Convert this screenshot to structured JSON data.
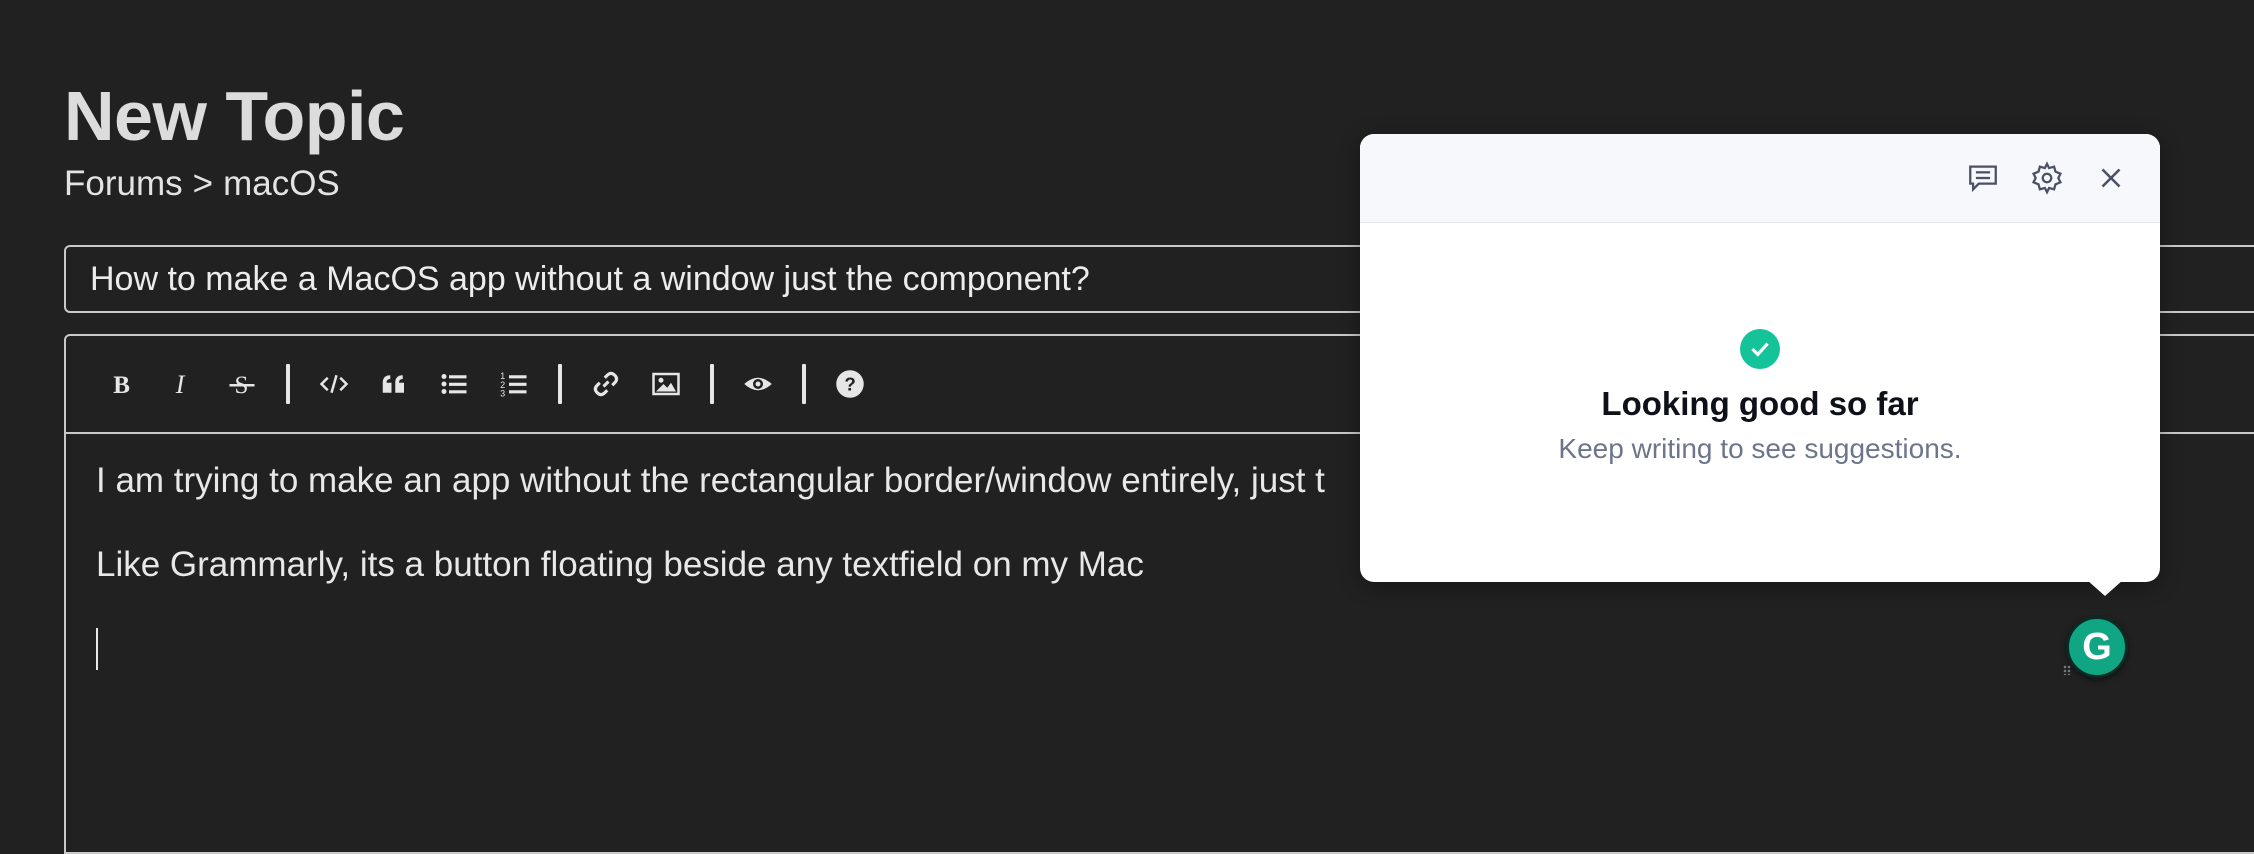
{
  "page": {
    "title": "New Topic",
    "breadcrumb": [
      "Forums",
      ">",
      "macOS"
    ]
  },
  "topic_title_value": "How to make a MacOS app without a window just the component?",
  "toolbar": {
    "buttons": [
      "bold-icon",
      "italic-icon",
      "strikethrough-icon",
      "code-icon",
      "quote-icon",
      "bullet-list-icon",
      "numbered-list-icon",
      "link-icon",
      "image-icon",
      "preview-eye-icon",
      "help-icon"
    ]
  },
  "editor": {
    "lines": [
      "I am trying to make an app without the rectangular border/window entirely, just t",
      "Like Grammarly, its a button floating beside any textfield on my Mac"
    ]
  },
  "grammarly_popup": {
    "title": "Looking good so far",
    "subtitle": "Keep writing to see suggestions.",
    "accent": "#15c39a",
    "button_letter": "G"
  }
}
